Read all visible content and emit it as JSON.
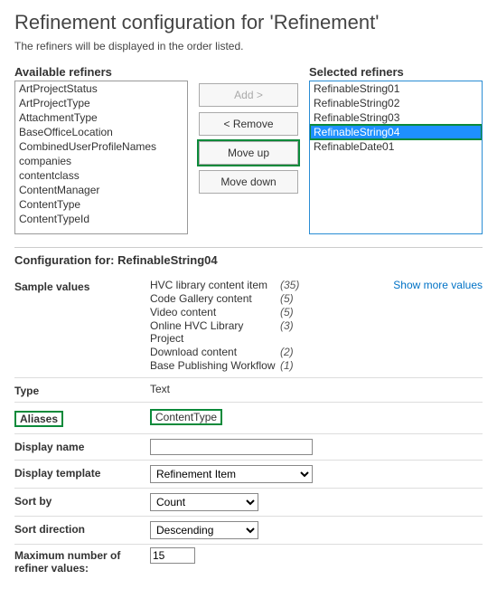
{
  "title": "Refinement configuration for 'Refinement'",
  "subtitle": "The refiners will be displayed in the order listed.",
  "available_label": "Available refiners",
  "selected_label": "Selected refiners",
  "buttons": {
    "add": "Add >",
    "remove": "< Remove",
    "moveup": "Move up",
    "movedown": "Move down"
  },
  "available": [
    "ArtProjectStatus",
    "ArtProjectType",
    "AttachmentType",
    "BaseOfficeLocation",
    "CombinedUserProfileNames",
    "companies",
    "contentclass",
    "ContentManager",
    "ContentType",
    "ContentTypeId"
  ],
  "selected": [
    {
      "label": "RefinableString01",
      "sel": false
    },
    {
      "label": "RefinableString02",
      "sel": false
    },
    {
      "label": "RefinableString03",
      "sel": false
    },
    {
      "label": "RefinableString04",
      "sel": true
    },
    {
      "label": "RefinableDate01",
      "sel": false
    }
  ],
  "config_heading": "Configuration for: RefinableString04",
  "labels": {
    "sample": "Sample values",
    "type": "Type",
    "aliases": "Aliases",
    "display_name": "Display name",
    "display_template": "Display template",
    "sort_by": "Sort by",
    "sort_direction": "Sort direction",
    "max_refiner": "Maximum number of refiner values:",
    "show_more": "Show more values"
  },
  "samples": [
    {
      "name": "HVC library content item",
      "count": "(35)"
    },
    {
      "name": "Code Gallery content",
      "count": "(5)"
    },
    {
      "name": "Video content",
      "count": "(5)"
    },
    {
      "name": "Online HVC Library Project",
      "count": "(3)"
    },
    {
      "name": "Download content",
      "count": "(2)"
    },
    {
      "name": "Base Publishing Workflow",
      "count": "(1)"
    }
  ],
  "values": {
    "type": "Text",
    "aliases": "ContentType",
    "display_name": "",
    "display_template": "Refinement Item",
    "sort_by": "Count",
    "sort_direction": "Descending",
    "max_refiner": "15"
  }
}
